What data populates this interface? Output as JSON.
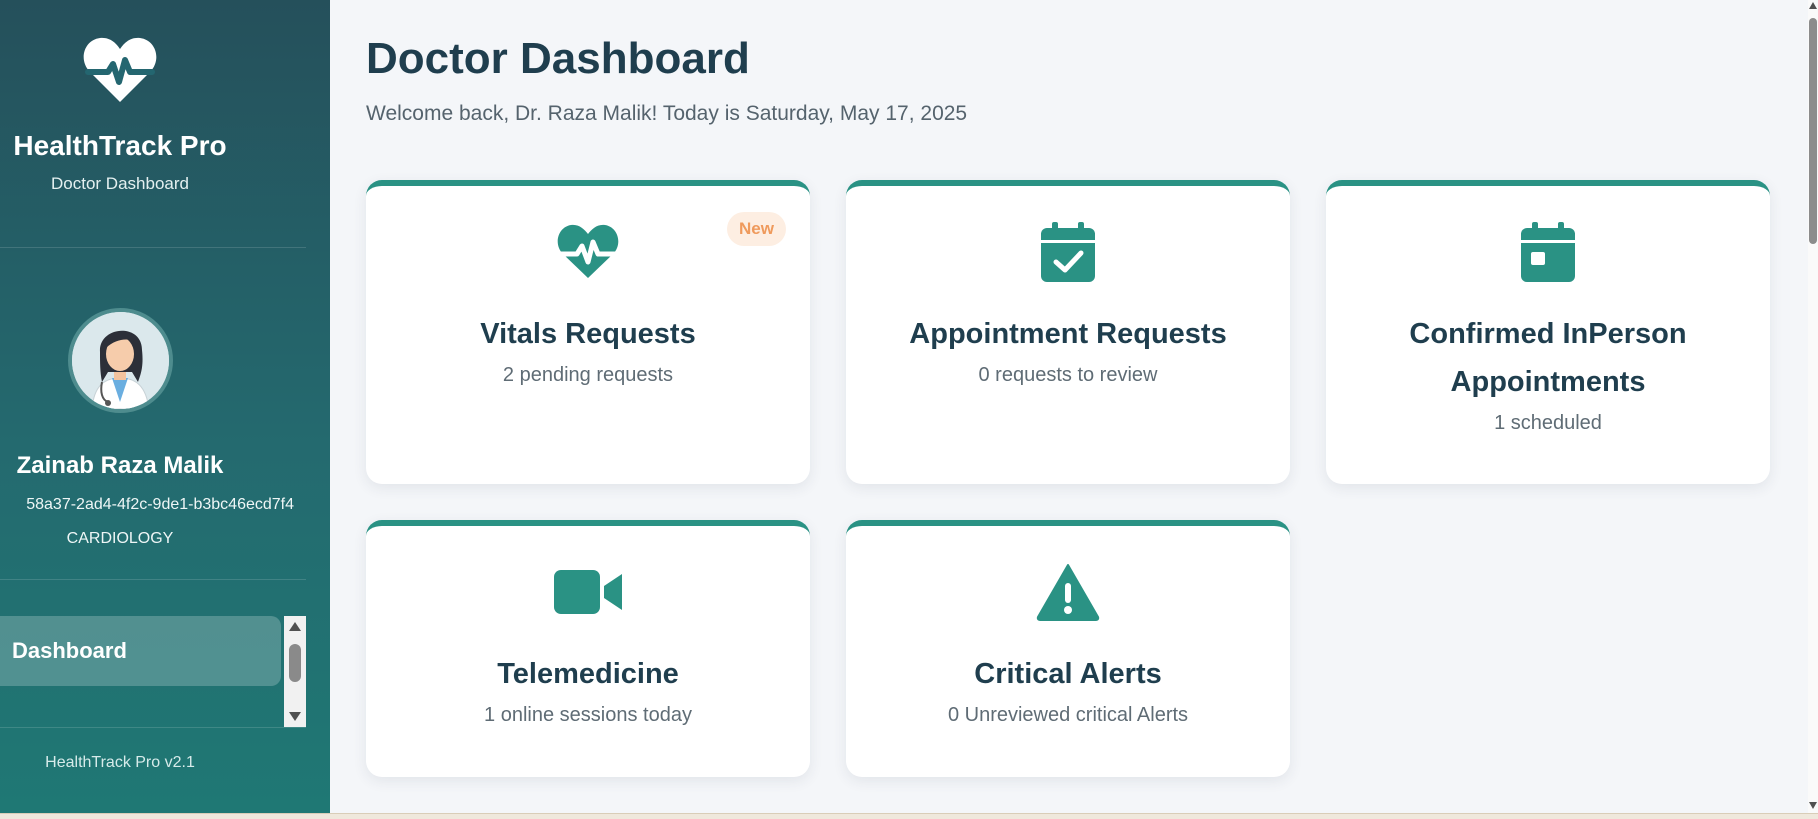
{
  "colors": {
    "accent": "#2a9284",
    "sidebar_top": "#25505b",
    "sidebar_bottom": "#1f7874",
    "badge_text": "#ef9a5c",
    "heading": "#1f3e4e"
  },
  "sidebar": {
    "logo_icon": "heartbeat-icon",
    "brand_title": "HealthTrack Pro",
    "brand_subtitle": "Doctor Dashboard",
    "doctor": {
      "name": "Zainab Raza Malik",
      "id": "58a37-2ad4-4f2c-9de1-b3bc46ecd7f4",
      "specialty": "CARDIOLOGY"
    },
    "nav": [
      {
        "label": "Dashboard",
        "active": true
      }
    ],
    "version": "HealthTrack Pro v2.1"
  },
  "main": {
    "title": "Doctor Dashboard",
    "welcome": "Welcome back, Dr. Raza Malik! Today is Saturday, May 17, 2025",
    "cards": [
      {
        "icon": "heartbeat-icon",
        "title": "Vitals Requests",
        "subtitle": "2 pending requests",
        "badge": "New"
      },
      {
        "icon": "calendar-check-icon",
        "title": "Appointment Requests",
        "subtitle": "0 requests to review"
      },
      {
        "icon": "calendar-day-icon",
        "title": "Confirmed InPerson Appointments",
        "subtitle": "1 scheduled"
      },
      {
        "icon": "video-icon",
        "title": "Telemedicine",
        "subtitle": "1 online sessions today"
      },
      {
        "icon": "warning-icon",
        "title": "Critical Alerts",
        "subtitle": "0 Unreviewed critical Alerts"
      }
    ]
  }
}
